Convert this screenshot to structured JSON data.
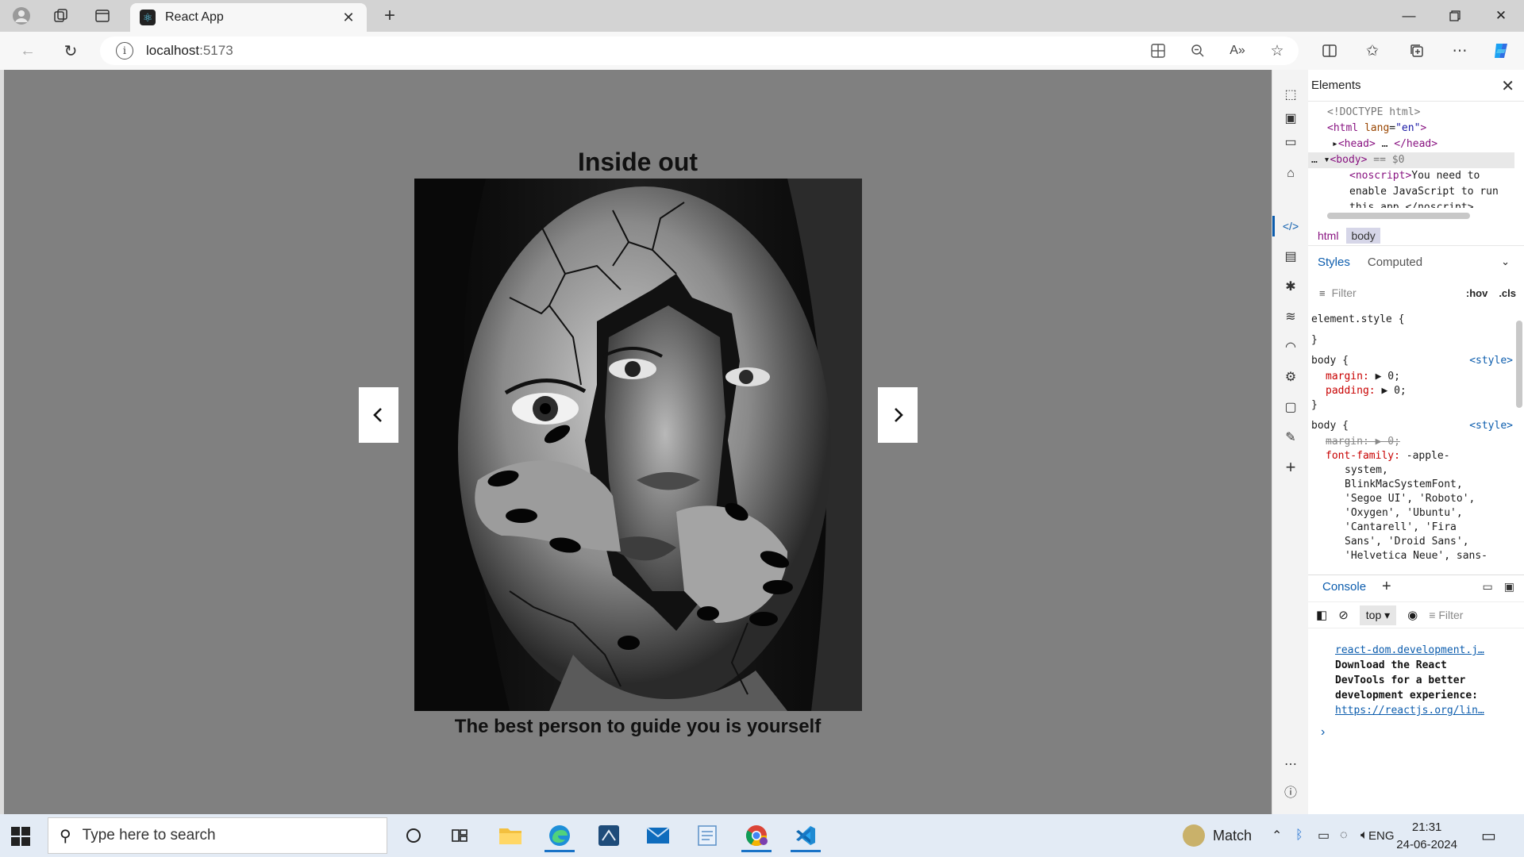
{
  "browser": {
    "tab_title": "React App",
    "url_host": "localhost",
    "url_port": ":5173"
  },
  "page": {
    "title": "Inside out",
    "caption": "The best person to guide you is yourself",
    "image_alt": "Black and white portrait of a woman with a cracked face and hands emerging"
  },
  "devtools": {
    "panel_title": "Elements",
    "dom": {
      "doctype": "<!DOCTYPE html>",
      "html_tag": "<html",
      "html_attr": "lang",
      "html_attr_value": "\"en\"",
      "head_open": "<head>",
      "head_close": "</head>",
      "body_tag": "<body>",
      "body_ref": "== $0",
      "noscript_open": "<noscript>",
      "noscript_text_1": "You need to",
      "noscript_text_2": "enable JavaScript to run",
      "noscript_text_3": "this app.</noscript>"
    },
    "breadcrumbs": [
      "html",
      "body"
    ],
    "subtabs": {
      "styles": "Styles",
      "computed": "Computed"
    },
    "filter": {
      "placeholder": "Filter",
      "hov": ":hov",
      "cls": ".cls"
    },
    "styles": {
      "element_style": "element.style {",
      "close_brace": "}",
      "body_selector": "body {",
      "source": "<style>",
      "margin_prop": "margin:",
      "margin_val": "▶ 0;",
      "padding_prop": "padding:",
      "padding_val": "▶ 0;",
      "margin_struck": "margin: ▶ 0;",
      "font_family_prop": "font-family:",
      "font_family_lines": [
        "-apple-",
        "system,",
        "BlinkMacSystemFont,",
        "'Segoe UI', 'Roboto',",
        "'Oxygen', 'Ubuntu',",
        "'Cantarell', 'Fira",
        "Sans', 'Droid Sans',",
        "'Helvetica Neue', sans-"
      ]
    },
    "console": {
      "tab": "Console",
      "context": "top",
      "filter_placeholder": "Filter",
      "msg_source": "react-dom.development.j…",
      "msg_lines": [
        "Download the React",
        "DevTools for a better",
        "development experience:"
      ],
      "msg_link": "https://reactjs.org/lin…"
    }
  },
  "taskbar": {
    "search_placeholder": "Type here to search",
    "weather_label": "Match",
    "language": "ENG",
    "time": "21:31",
    "date": "24-06-2024"
  },
  "colors": {
    "viewport_bg": "#808080",
    "accent": "#0b5cad"
  }
}
